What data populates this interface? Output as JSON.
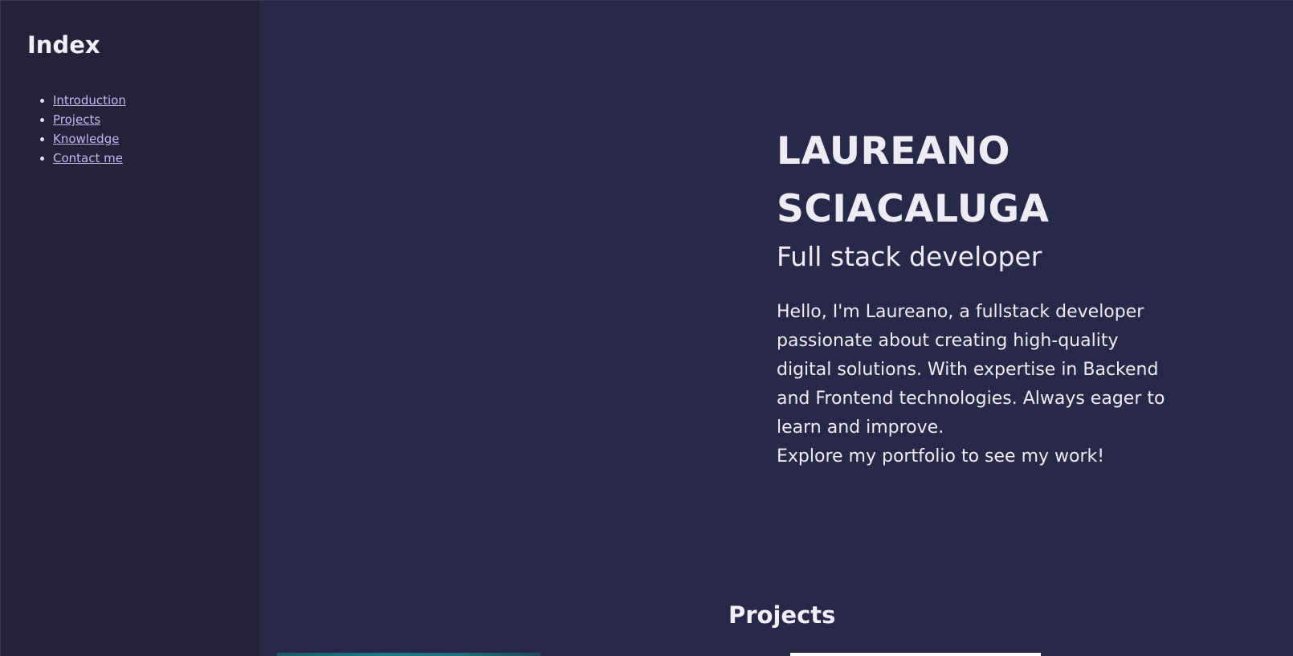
{
  "sidebar": {
    "title": "Index",
    "items": [
      {
        "label": "Introduction"
      },
      {
        "label": "Projects"
      },
      {
        "label": "Knowledge"
      },
      {
        "label": "Contact me"
      }
    ]
  },
  "hero": {
    "name_line1": "LAUREANO",
    "name_line2": "SCIACALUGA",
    "subtitle": "Full stack developer",
    "bio": "Hello, I'm Laureano, a fullstack developer passionate about creating high-quality digital solutions. With expertise in Backend and Frontend technologies. Always eager to learn and improve.",
    "cta": "Explore my portfolio to see my work!"
  },
  "projects": {
    "title": "Projects"
  },
  "colors": {
    "background": "#2a2848",
    "sidebar_background": "#242238",
    "link": "#c9b5f0",
    "text": "#edecf5"
  }
}
